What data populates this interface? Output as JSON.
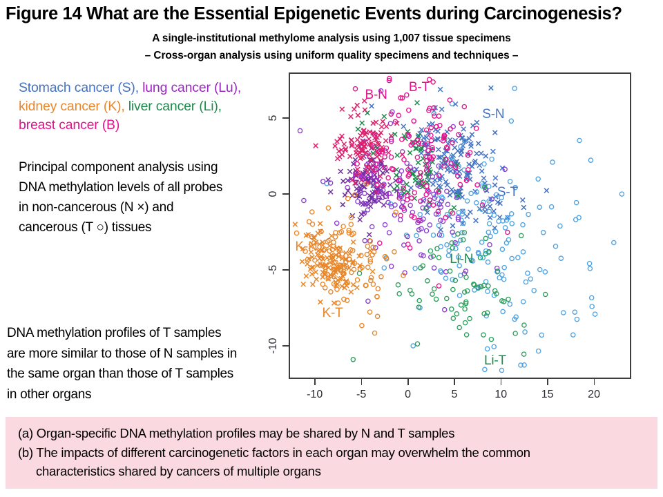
{
  "title": "Figure 14   What are the Essential Epigenetic Events during Carcinogenesis?",
  "subtitle1": "A single-institutional  methylome analysis using 1,007 tissue specimens",
  "subtitle2": "– Cross-organ  analysis using uniform quality specimens and techniques –",
  "legend": {
    "line1_a": "Stomach cancer (S), ",
    "line1_b": "lung cancer (Lu),",
    "line2_a": "kidney cancer (K), ",
    "line2_b": "liver cancer (Li),",
    "line3": "breast cancer (B)"
  },
  "description": {
    "method_l1": "Principal component analysis using",
    "method_l2": "DNA methylation levels of all probes",
    "method_l3": "in non-cancerous (N ×) and",
    "method_l4": "cancerous (T ○) tissues",
    "conclusion_l1": "DNA methylation profiles of T samples",
    "conclusion_l2": "are more similar to those of N samples in",
    "conclusion_l3": "the same organ than those of T samples",
    "conclusion_l4": "in other organs"
  },
  "findings": {
    "a": "(a) Organ-specific DNA methylation profiles may be shared by N and T samples",
    "b": "(b) The impacts of different carcinogenetic factors in each organ may overwhelm the common",
    "b_cont": "characteristics shared by cancers of multiple organs"
  },
  "colors": {
    "stomach": "#4472C4",
    "lung": "#7030A0",
    "kidney": "#E8862A",
    "liver": "#1E8A4C",
    "breast": "#E8108F",
    "breast_n": "#E0216E",
    "frame": "#3d3d3d",
    "box_bg": "#fbd9e0",
    "text": "#000000"
  },
  "chart_data": {
    "type": "scatter",
    "title": "",
    "xlabel": "",
    "ylabel": "",
    "xlim": [
      -12.8,
      24.0
    ],
    "ylim": [
      -12.2,
      8.0
    ],
    "xticks": [
      -10,
      -5,
      0,
      5,
      10,
      15,
      20
    ],
    "yticks": [
      5,
      0,
      -5,
      -10
    ],
    "grid": false,
    "legend_position": "in-plot-annotations",
    "marker_meaning": {
      "x": "non-cancerous (N)",
      "o": "cancerous (T)"
    },
    "annotations": [
      {
        "text": "B-N",
        "x": -4.6,
        "y": 6.45,
        "color": "#E8108F"
      },
      {
        "text": "B-T",
        "x": 0.1,
        "y": 6.95,
        "color": "#E8108F"
      },
      {
        "text": "S-N",
        "x": 8.0,
        "y": 5.2,
        "color": "#4472C4"
      },
      {
        "text": "S-T",
        "x": 9.6,
        "y": 0.05,
        "color": "#4472C4"
      },
      {
        "text": "Lu-N",
        "x": -6.0,
        "y": 1.05,
        "color": "#9C27C4"
      },
      {
        "text": "Lu-T",
        "x": -3.5,
        "y": -0.15,
        "color": "#9C27C4"
      },
      {
        "text": "K-N",
        "x": -12.1,
        "y": -3.55,
        "color": "#E8862A"
      },
      {
        "text": "K-T",
        "x": -9.2,
        "y": -7.9,
        "color": "#E8862A"
      },
      {
        "text": "Li-N",
        "x": 4.5,
        "y": -4.35,
        "color": "#1E8A4C"
      },
      {
        "text": "Li-T",
        "x": 8.2,
        "y": -11.05,
        "color": "#1E8A4C"
      }
    ],
    "series": [
      {
        "name": "Stomach N",
        "label": "S-N",
        "color": "#4472C4",
        "marker": "x",
        "n": 160,
        "cx": 5.2,
        "cy": 1.6,
        "sx": 2.9,
        "sy": 1.9,
        "rot": -0.45,
        "seed": 11
      },
      {
        "name": "Stomach T",
        "label": "S-T",
        "color": "#4FA3E3",
        "marker": "o",
        "n": 165,
        "cx": 8.2,
        "cy": -3.0,
        "sx": 4.6,
        "sy": 3.1,
        "rot": -0.35,
        "seed": 23
      },
      {
        "name": "Lung N",
        "label": "Lu-N",
        "color": "#7030A0",
        "marker": "x",
        "n": 100,
        "cx": -4.3,
        "cy": 0.75,
        "sx": 1.25,
        "sy": 1.05,
        "rot": 0.5,
        "seed": 37
      },
      {
        "name": "Lung T",
        "label": "Lu-T",
        "color": "#8B3FD0",
        "marker": "o",
        "n": 120,
        "cx": 0.6,
        "cy": -1.2,
        "sx": 3.4,
        "sy": 2.4,
        "rot": -0.25,
        "seed": 41
      },
      {
        "name": "Kidney N",
        "label": "K-N",
        "color": "#E8862A",
        "marker": "x",
        "n": 105,
        "cx": -8.2,
        "cy": -4.6,
        "sx": 1.7,
        "sy": 0.95,
        "rot": -0.35,
        "seed": 53
      },
      {
        "name": "Kidney T",
        "label": "K-T",
        "color": "#E8862A",
        "marker": "o",
        "n": 105,
        "cx": -6.3,
        "cy": -4.5,
        "sx": 2.5,
        "sy": 1.5,
        "rot": -0.4,
        "seed": 67
      },
      {
        "name": "Liver N",
        "label": "Li-N",
        "color": "#1E8A4C",
        "marker": "x",
        "n": 55,
        "cx": 0.7,
        "cy": 2.1,
        "sx": 2.1,
        "sy": 1.6,
        "rot": -0.3,
        "seed": 71
      },
      {
        "name": "Liver T",
        "label": "Li-T",
        "color": "#2E9E5C",
        "marker": "o",
        "n": 75,
        "cx": 5.3,
        "cy": -6.2,
        "sx": 3.2,
        "sy": 2.8,
        "rot": -0.3,
        "seed": 83
      },
      {
        "name": "Breast N",
        "label": "B-N",
        "color": "#E0216E",
        "marker": "x",
        "n": 100,
        "cx": -4.5,
        "cy": 3.1,
        "sx": 1.6,
        "sy": 1.3,
        "rot": 0.35,
        "seed": 97
      },
      {
        "name": "Breast T",
        "label": "B-T",
        "color": "#E8108F",
        "marker": "o",
        "n": 120,
        "cx": 1.3,
        "cy": 2.6,
        "sx": 3.0,
        "sy": 2.2,
        "rot": -0.4,
        "seed": 101
      }
    ]
  }
}
